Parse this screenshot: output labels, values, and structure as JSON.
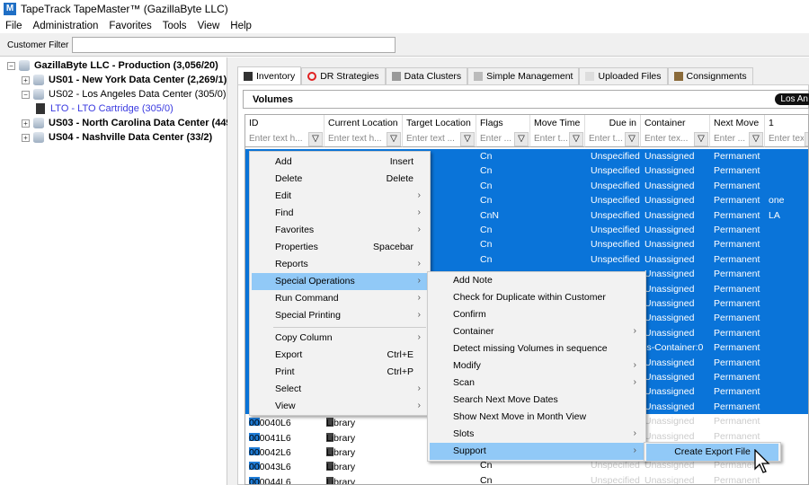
{
  "window": {
    "title": "TapeTrack TapeMaster™ (GazillaByte LLC)",
    "icon_letter": "M"
  },
  "menubar": [
    "File",
    "Administration",
    "Favorites",
    "Tools",
    "View",
    "Help"
  ],
  "customer_filter": {
    "label": "Customer Filter",
    "value": ""
  },
  "tree": [
    {
      "label": "GazillaByte LLC - Production (3,056/20)",
      "bold": true,
      "level": 0,
      "expander": "-",
      "icon": "database-icon"
    },
    {
      "label": "US01 - New York Data Center (2,269/1)",
      "bold": true,
      "level": 1,
      "expander": "+",
      "icon": "database-icon"
    },
    {
      "label": "US02 - Los Angeles Data Center (305/0)",
      "bold": false,
      "level": 1,
      "expander": "-",
      "icon": "database-icon"
    },
    {
      "label": "LTO - LTO Cartridge (305/0)",
      "bold": false,
      "level": 2,
      "expander": "",
      "icon": "cartridge-icon",
      "color": "#3a3ae0"
    },
    {
      "label": "US03 - North Carolina Data Center (449/",
      "bold": true,
      "level": 1,
      "expander": "+",
      "icon": "database-icon"
    },
    {
      "label": "US04 - Nashville Data Center (33/2)",
      "bold": true,
      "level": 1,
      "expander": "+",
      "icon": "database-icon"
    }
  ],
  "tabs": [
    {
      "label": "Inventory",
      "icon": "cartridge-icon",
      "active": true
    },
    {
      "label": "DR Strategies",
      "icon": "lifebuoy-icon"
    },
    {
      "label": "Data Clusters",
      "icon": "cluster-icon"
    },
    {
      "label": "Simple Management",
      "icon": "management-icon"
    },
    {
      "label": "Uploaded Files",
      "icon": "file-icon"
    },
    {
      "label": "Consignments",
      "icon": "box-icon"
    }
  ],
  "volumes": {
    "title": "Volumes",
    "badge": "Los An"
  },
  "grid": {
    "columns": [
      "ID",
      "Current Location",
      "Target Location",
      "Flags",
      "Move Time",
      "Due in",
      "Container",
      "Next Move",
      "1"
    ],
    "filter_placeholders": [
      "Enter text h...",
      "Enter text h...",
      "Enter text ...",
      "Enter ...",
      "Enter t...",
      "Enter t...",
      "Enter tex...",
      "Enter ...",
      "Enter tex"
    ],
    "selected_rows": [
      {
        "flags": "Cn",
        "due": "Unspecified",
        "container": "Unassigned",
        "next": "Permanent",
        "c1": ""
      },
      {
        "flags": "Cn",
        "due": "Unspecified",
        "container": "Unassigned",
        "next": "Permanent",
        "c1": ""
      },
      {
        "flags": "Cn",
        "due": "Unspecified",
        "container": "Unassigned",
        "next": "Permanent",
        "c1": ""
      },
      {
        "flags": "Cn",
        "due": "Unspecified",
        "container": "Unassigned",
        "next": "Permanent",
        "c1": "one"
      },
      {
        "flags": "CnN",
        "due": "Unspecified",
        "container": "Unassigned",
        "next": "Permanent",
        "c1": "LA"
      },
      {
        "flags": "Cn",
        "due": "Unspecified",
        "container": "Unassigned",
        "next": "Permanent",
        "c1": ""
      },
      {
        "flags": "Cn",
        "due": "Unspecified",
        "container": "Unassigned",
        "next": "Permanent",
        "c1": ""
      },
      {
        "flags": "Cn",
        "due": "Unspecified",
        "container": "Unassigned",
        "next": "Permanent",
        "c1": ""
      },
      {
        "flags": "",
        "due": "",
        "container": "Unassigned",
        "next": "Permanent",
        "c1": ""
      },
      {
        "flags": "",
        "due": "",
        "container": "Unassigned",
        "next": "Permanent",
        "c1": ""
      },
      {
        "flags": "",
        "due": "",
        "container": "Unassigned",
        "next": "Permanent",
        "c1": ""
      },
      {
        "flags": "",
        "due": "",
        "container": "Unassigned",
        "next": "Permanent",
        "c1": ""
      },
      {
        "flags": "",
        "due": "",
        "container": "Unassigned",
        "next": "Permanent",
        "c1": ""
      },
      {
        "flags": "",
        "due": "",
        "container": "is-Container:0",
        "next": "Permanent",
        "c1": ""
      },
      {
        "flags": "",
        "due": "",
        "container": "Unassigned",
        "next": "Permanent",
        "c1": ""
      },
      {
        "flags": "",
        "due": "",
        "container": "Unassigned",
        "next": "Permanent",
        "c1": ""
      },
      {
        "flags": "",
        "due": "",
        "container": "Unassigned",
        "next": "Permanent",
        "c1": ""
      },
      {
        "flags": "",
        "due": "",
        "container": "Unassigned",
        "next": "Permanent",
        "c1": ""
      }
    ],
    "rows": [
      {
        "id": "000040L6",
        "location": "Library",
        "flags": "",
        "due": "",
        "container": "Unassigned",
        "next": "Permanent"
      },
      {
        "id": "000041L6",
        "location": "Library",
        "flags": "",
        "due": "",
        "container": "Unassigned",
        "next": "Permanent"
      },
      {
        "id": "000042L6",
        "location": "Library",
        "flags": "",
        "due": "",
        "container": "Unassigned",
        "next": "Permanent"
      },
      {
        "id": "000043L6",
        "location": "Library",
        "flags": "Cn",
        "due": "Unspecified",
        "container": "Unassigned",
        "next": "Permanent"
      },
      {
        "id": "000044L6",
        "location": "Library",
        "flags": "Cn",
        "due": "Unspecified",
        "container": "Unassigned",
        "next": "Permanent"
      }
    ]
  },
  "context_menu": [
    {
      "label": "Add",
      "shortcut": "Insert"
    },
    {
      "label": "Delete",
      "shortcut": "Delete"
    },
    {
      "label": "Edit",
      "submenu": true
    },
    {
      "label": "Find",
      "submenu": true
    },
    {
      "label": "Favorites",
      "submenu": true
    },
    {
      "label": "Properties",
      "shortcut": "Spacebar"
    },
    {
      "label": "Reports",
      "submenu": true
    },
    {
      "label": "Special Operations",
      "submenu": true,
      "highlighted": true
    },
    {
      "label": "Run Command",
      "submenu": true
    },
    {
      "label": "Special Printing",
      "submenu": true
    },
    {
      "separator": true
    },
    {
      "label": "Copy Column",
      "submenu": true
    },
    {
      "label": "Export",
      "shortcut": "Ctrl+E"
    },
    {
      "label": "Print",
      "shortcut": "Ctrl+P"
    },
    {
      "label": "Select",
      "submenu": true
    },
    {
      "label": "View",
      "submenu": true
    }
  ],
  "special_operations_menu": [
    {
      "label": "Add Note"
    },
    {
      "label": "Check for Duplicate within Customer"
    },
    {
      "label": "Confirm"
    },
    {
      "label": "Container",
      "submenu": true
    },
    {
      "label": "Detect missing Volumes in sequence"
    },
    {
      "label": "Modify",
      "submenu": true
    },
    {
      "label": "Scan",
      "submenu": true
    },
    {
      "label": "Search Next Move Dates"
    },
    {
      "label": "Show Next Move in Month View"
    },
    {
      "label": "Slots",
      "submenu": true
    },
    {
      "label": "Support",
      "submenu": true,
      "highlighted": true
    }
  ],
  "support_menu": [
    {
      "label": "Create Export File",
      "highlighted": true
    }
  ],
  "colors": {
    "selection": "#0a74d9",
    "menu_highlight": "#91c9f7",
    "tree_link": "#3a3ae0"
  }
}
